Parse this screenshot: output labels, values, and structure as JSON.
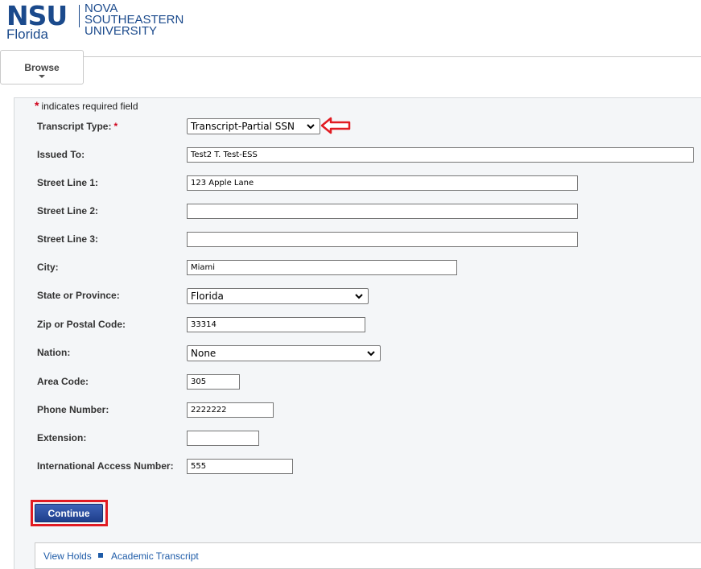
{
  "header": {
    "logo_nsu": "NSU",
    "logo_florida": "Florida",
    "logo_uni_line1": "NOVA SOUTHEASTERN",
    "logo_uni_line2": "UNIVERSITY",
    "browse_label": "Browse"
  },
  "form": {
    "required_star": "*",
    "required_note": "indicates required field",
    "transcript_type": {
      "label": "Transcript Type:",
      "value": "Transcript-Partial SSN"
    },
    "issued_to": {
      "label": "Issued To:",
      "value": "Test2 T. Test-ESS"
    },
    "street1": {
      "label": "Street Line 1:",
      "value": "123 Apple Lane"
    },
    "street2": {
      "label": "Street Line 2:",
      "value": ""
    },
    "street3": {
      "label": "Street Line 3:",
      "value": ""
    },
    "city": {
      "label": "City:",
      "value": "Miami"
    },
    "state": {
      "label": "State or Province:",
      "value": "Florida"
    },
    "zip": {
      "label": "Zip or Postal Code:",
      "value": "33314"
    },
    "nation": {
      "label": "Nation:",
      "value": "None"
    },
    "area_code": {
      "label": "Area Code:",
      "value": "305"
    },
    "phone": {
      "label": "Phone Number:",
      "value": "2222222"
    },
    "extension": {
      "label": "Extension:",
      "value": ""
    },
    "intl_access": {
      "label": "International Access Number:",
      "value": "555"
    },
    "continue_label": "Continue"
  },
  "footer": {
    "link1": "View Holds",
    "link2": "Academic Transcript"
  },
  "colors": {
    "brand_blue": "#1b4a8c",
    "required_red": "#d0021b",
    "highlight_red": "#e11b22",
    "link_blue": "#1f5ca8"
  }
}
